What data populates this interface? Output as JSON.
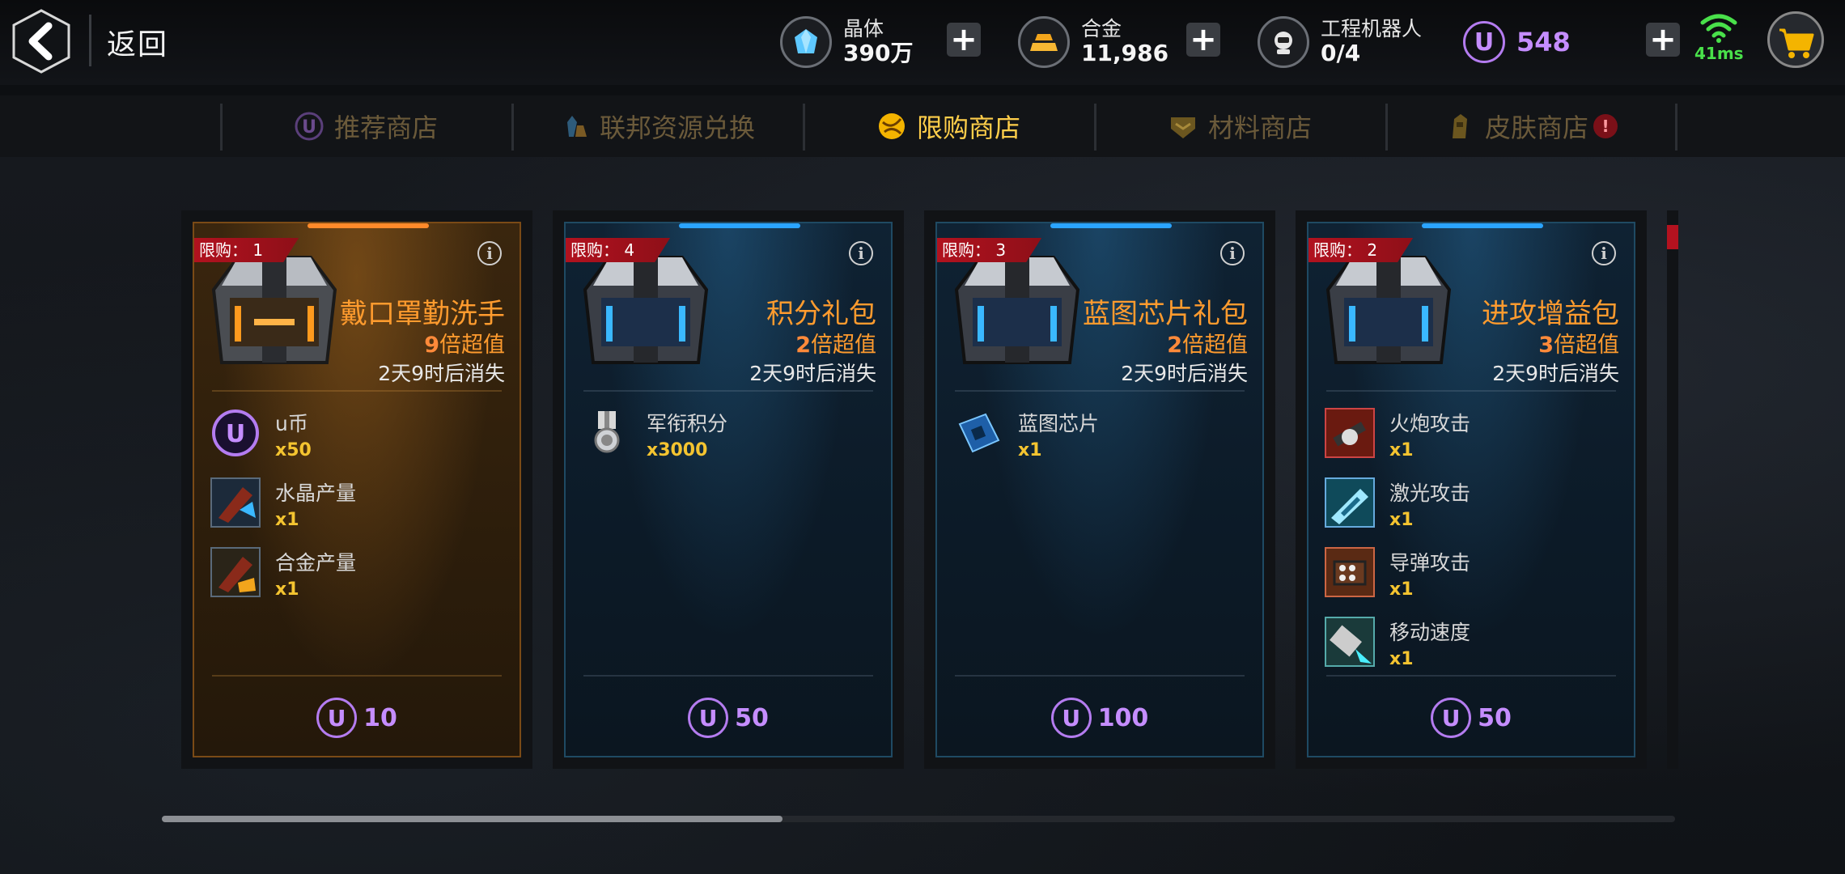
{
  "header": {
    "back_label": "返回",
    "resources": [
      {
        "label": "晶体",
        "value": "390万",
        "icon": "crystal-icon"
      },
      {
        "label": "合金",
        "value": "11,986",
        "icon": "alloy-icon"
      },
      {
        "label": "工程机器人",
        "value": "0/4",
        "icon": "robot-icon"
      }
    ],
    "ucoin": {
      "symbol": "U",
      "value": "548"
    },
    "ping": "41ms",
    "plus_symbol": "+"
  },
  "tabs": [
    {
      "label": "推荐商店",
      "icon": "u-coin-icon",
      "active": false
    },
    {
      "label": "联邦资源兑换",
      "icon": "resources-icon",
      "active": false
    },
    {
      "label": "限购商店",
      "icon": "limited-shop-icon",
      "active": true
    },
    {
      "label": "材料商店",
      "icon": "materials-icon",
      "active": false
    },
    {
      "label": "皮肤商店",
      "icon": "skin-icon",
      "active": false,
      "badge": "!"
    }
  ],
  "cards": [
    {
      "style": "gold",
      "limit": "限购： 1",
      "name": "戴口罩勤洗手",
      "mult_num": "9",
      "mult_text": "倍超值",
      "time": "2天9时后消失",
      "items": [
        {
          "name": "u币",
          "qty": "x50",
          "icon": "u-coin-icon"
        },
        {
          "name": "水晶产量",
          "qty": "x1",
          "icon": "crystal-production-icon"
        },
        {
          "name": "合金产量",
          "qty": "x1",
          "icon": "alloy-production-icon"
        }
      ],
      "price": "10"
    },
    {
      "style": "blue",
      "limit": "限购： 4",
      "name": "积分礼包",
      "mult_num": "2",
      "mult_text": "倍超值",
      "time": "2天9时后消失",
      "items": [
        {
          "name": "军衔积分",
          "qty": "x3000",
          "icon": "rank-medal-icon"
        }
      ],
      "price": "50"
    },
    {
      "style": "blue",
      "limit": "限购： 3",
      "name": "蓝图芯片礼包",
      "mult_num": "2",
      "mult_text": "倍超值",
      "time": "2天9时后消失",
      "items": [
        {
          "name": "蓝图芯片",
          "qty": "x1",
          "icon": "blueprint-chip-icon"
        }
      ],
      "price": "100"
    },
    {
      "style": "blue",
      "limit": "限购： 2",
      "name": "进攻增益包",
      "mult_num": "3",
      "mult_text": "倍超值",
      "time": "2天9时后消失",
      "items": [
        {
          "name": "火炮攻击",
          "qty": "x1",
          "icon": "cannon-attack-icon"
        },
        {
          "name": "激光攻击",
          "qty": "x1",
          "icon": "laser-attack-icon"
        },
        {
          "name": "导弹攻击",
          "qty": "x1",
          "icon": "missile-attack-icon"
        },
        {
          "name": "移动速度",
          "qty": "x1",
          "icon": "move-speed-icon"
        }
      ],
      "price": "50"
    }
  ],
  "colors": {
    "accent_gold": "#ffce4a",
    "ucoin_purple": "#c58dff",
    "name_orange": "#ff9b2e",
    "qty_yellow": "#f4c430",
    "limit_red": "#b3121f",
    "ping_green": "#49e04a"
  },
  "scroll_progress": 0.41
}
